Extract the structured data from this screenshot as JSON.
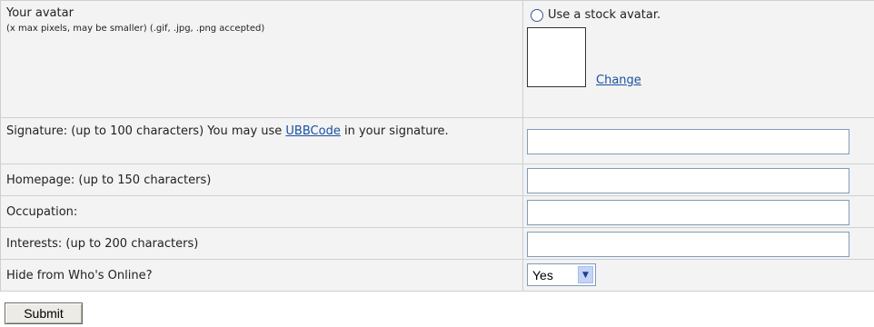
{
  "avatar": {
    "label": "Your avatar",
    "sublabel": "(x max pixels, may be smaller) (.gif, .jpg, .png accepted)",
    "radio_label": "Use a stock avatar.",
    "change_link": "Change"
  },
  "signature": {
    "label_before": "Signature: (up to 100 characters) You may use ",
    "link": "UBBCode",
    "label_after": " in your signature.",
    "value": ""
  },
  "homepage": {
    "label": "Homepage: (up to 150 characters)",
    "value": ""
  },
  "occupation": {
    "label": "Occupation:",
    "value": ""
  },
  "interests": {
    "label": "Interests: (up to 200 characters)",
    "value": ""
  },
  "hide_online": {
    "label": "Hide from Who's Online?",
    "selected": "Yes"
  },
  "submit_label": "Submit"
}
